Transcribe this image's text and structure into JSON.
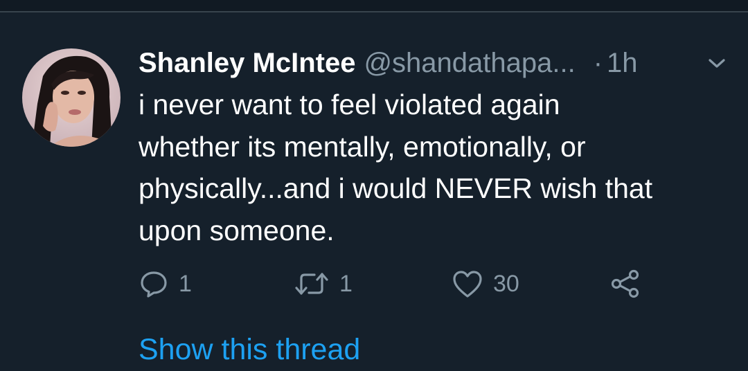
{
  "tweet": {
    "display_name": "Shanley McIntee",
    "handle": "@shandathapa...",
    "separator": "·",
    "time": "1h",
    "text": "i never want to feel violated again\nwhether its mentally, emotionally, or\nphysically...and i would NEVER wish that\nupon someone."
  },
  "actions": {
    "reply_count": "1",
    "retweet_count": "1",
    "like_count": "30"
  },
  "thread_link_label": "Show this thread",
  "icons": {
    "reply": "reply-icon",
    "retweet": "retweet-icon",
    "like": "heart-icon",
    "share": "share-icon",
    "menu": "chevron-down-icon"
  },
  "colors": {
    "background": "#15202b",
    "secondary_text": "#8899a6",
    "link": "#1da1f2"
  }
}
